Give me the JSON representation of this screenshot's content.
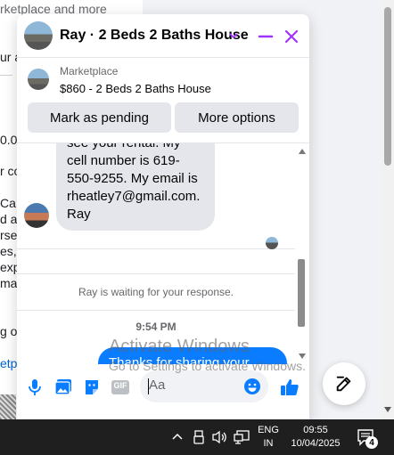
{
  "background": {
    "fragments": [
      "rketplace and more",
      "ur a",
      "0.0",
      "r co",
      "Ca",
      "d ap",
      "rse",
      "es,",
      "exp",
      "mand",
      "g o",
      "etpl"
    ]
  },
  "chat": {
    "title": "Ray · 2 Beds 2 Baths House",
    "listing": {
      "label": "Marketplace",
      "price_title": "$860 - 2 Beds 2 Baths House"
    },
    "buttons": {
      "pending": "Mark as pending",
      "more": "More options"
    },
    "messages": {
      "incoming_text": "see your rental. My cell number is 619-550-9255. My email is rheatley7@gmail.com. Ray",
      "waiting_notice": "Ray is waiting for your response.",
      "timestamp": "9:54 PM",
      "outgoing_text": "Thanks for sharing your"
    },
    "composer": {
      "placeholder": "Aa",
      "gif_label": "GIF"
    }
  },
  "watermark": {
    "line1": "Activate Windows",
    "line2": "Go to Settings to activate Windows."
  },
  "taskbar": {
    "lang_line1": "ENG",
    "lang_line2": "IN",
    "time": "09:55",
    "date": "10/04/2025",
    "notification_count": "4"
  },
  "colors": {
    "accent": "#0a7cff",
    "close_purple": "#a033ff",
    "taskbar": "#1f1f1f"
  }
}
